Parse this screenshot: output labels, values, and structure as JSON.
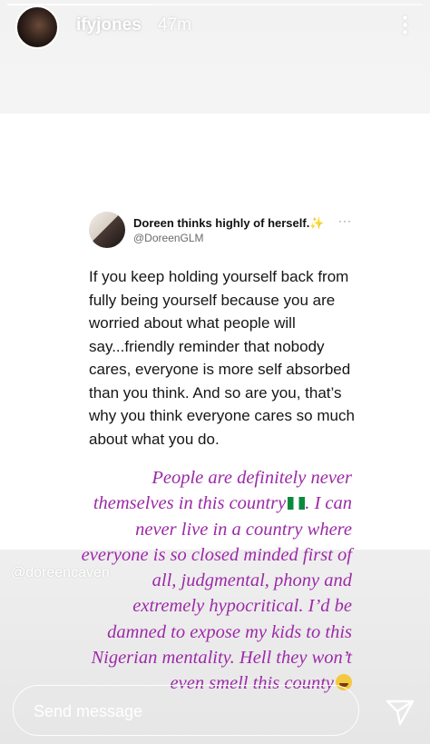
{
  "story": {
    "username": "ifyjones",
    "time_ago": "47m",
    "mention": "@doreencaven"
  },
  "tweet": {
    "name": "Doreen thinks highly of herself.",
    "sparkle": "✨",
    "handle": "@DoreenGLM",
    "more": "···",
    "text": "If you keep holding yourself back from fully being yourself because you are worried about what people will say...friendly reminder that nobody cares, everyone is more self absorbed than you think. And so are you, that’s why you think everyone cares so much about what you do."
  },
  "overlay": {
    "line1": "People are definitely never themselves in this country",
    "line2": ". I can never live in a country where everyone is so closed minded first of all, judgmental, phony and extremely hypocritical. I’d be damned to expose my kids to this Nigerian mentality. Hell they won’t even smell this county",
    "flag_icon": "nigeria-flag-icon",
    "emoji_icon": "laughing-emoji-icon"
  },
  "reply": {
    "placeholder": "Send message"
  },
  "colors": {
    "overlay_text": "#9b2aa6",
    "background": "#f2f2f2"
  }
}
